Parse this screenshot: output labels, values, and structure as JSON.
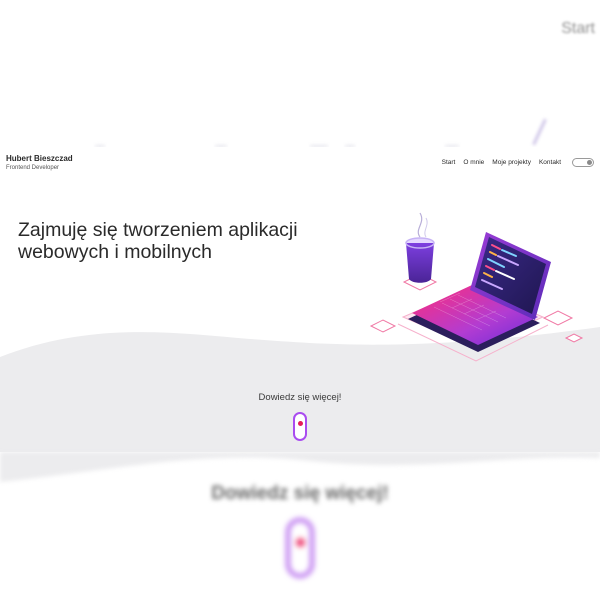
{
  "background": {
    "blurred_nav_label": "Start",
    "blurred_cta": "Dowiedz się więcej!"
  },
  "header": {
    "name": "Hubert Bieszczad",
    "role": "Frontend Developer"
  },
  "nav": {
    "items": [
      {
        "label": "Start"
      },
      {
        "label": "O mnie"
      },
      {
        "label": "Moje projekty"
      },
      {
        "label": "Kontakt"
      }
    ],
    "theme_toggle_on": false
  },
  "hero": {
    "title": "Zajmuję się tworzeniem aplikacji webowych i mobilnych",
    "cta": "Dowiedz się więcej!"
  },
  "icons": {
    "illustration": "laptop-coffee-illustration",
    "scroll": "scroll-mouse-icon"
  },
  "colors": {
    "accent_purple": "#7c3aed",
    "accent_pink": "#e61b59",
    "gradient_start": "#ff2d78",
    "gradient_end": "#6a2bd9",
    "laptop_dark": "#2b1e5c",
    "wave_gray": "#ececee"
  }
}
